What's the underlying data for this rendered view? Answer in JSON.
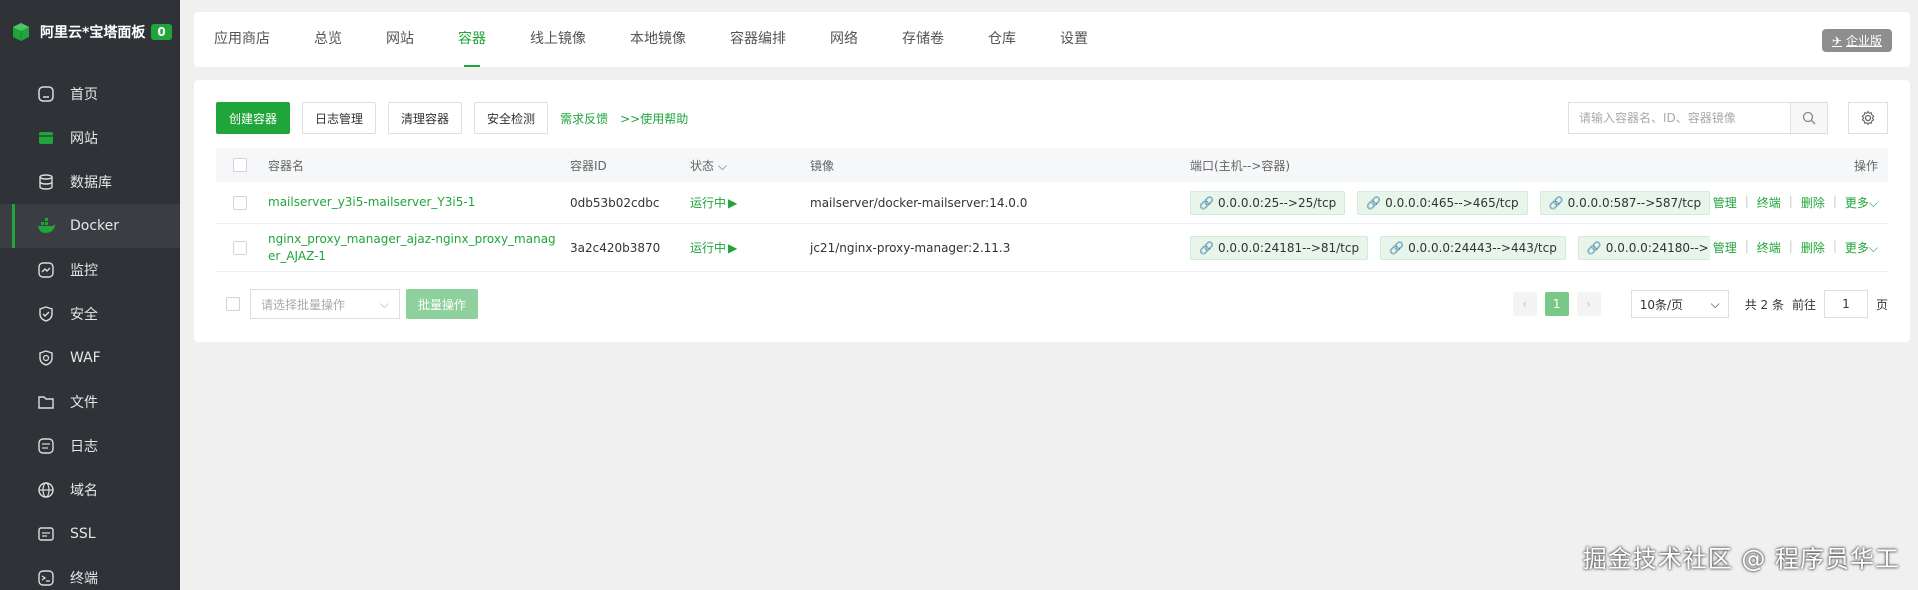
{
  "brand": {
    "title": "阿里云*宝塔面板",
    "badge": "0"
  },
  "sidebar": {
    "items": [
      {
        "label": "首页",
        "icon": "home-icon"
      },
      {
        "label": "网站",
        "icon": "globe-icon"
      },
      {
        "label": "数据库",
        "icon": "database-icon"
      },
      {
        "label": "Docker",
        "icon": "docker-icon"
      },
      {
        "label": "监控",
        "icon": "monitor-icon"
      },
      {
        "label": "安全",
        "icon": "shield-icon"
      },
      {
        "label": "WAF",
        "icon": "waf-icon"
      },
      {
        "label": "文件",
        "icon": "folder-icon"
      },
      {
        "label": "日志",
        "icon": "log-icon"
      },
      {
        "label": "域名",
        "icon": "domain-icon"
      },
      {
        "label": "SSL",
        "icon": "ssl-icon"
      },
      {
        "label": "终端",
        "icon": "terminal-icon"
      }
    ],
    "active": "Docker"
  },
  "tabs": [
    "应用商店",
    "总览",
    "网站",
    "容器",
    "线上镜像",
    "本地镜像",
    "容器编排",
    "网络",
    "存储卷",
    "仓库",
    "设置"
  ],
  "active_tab": "容器",
  "enterprise_label": "企业版",
  "toolbar": {
    "create": "创建容器",
    "logs": "日志管理",
    "clean": "清理容器",
    "security": "安全检测",
    "feedback": "需求反馈",
    "help": ">>使用帮助"
  },
  "search": {
    "placeholder": "请输入容器名、ID、容器镜像"
  },
  "table": {
    "headers": {
      "name": "容器名",
      "id": "容器ID",
      "status": "状态",
      "image": "镜像",
      "ports": "端口(主机-->容器)",
      "ops": "操作"
    },
    "rows": [
      {
        "name": "mailserver_y3i5-mailserver_Y3i5-1",
        "id": "0db53b02cdbc",
        "status": "运行中",
        "image": "mailserver/docker-mailserver:14.0.0",
        "ports": [
          "0.0.0.0:25-->25/tcp",
          "0.0.0.0:465-->465/tcp",
          "0.0.0.0:587-->587/tcp"
        ]
      },
      {
        "name": "nginx_proxy_manager_ajaz-nginx_proxy_manager_AJAZ-1",
        "id": "3a2c420b3870",
        "status": "运行中",
        "image": "jc21/nginx-proxy-manager:2.11.3",
        "ports": [
          "0.0.0.0:24181-->81/tcp",
          "0.0.0.0:24443-->443/tcp",
          "0.0.0.0:24180-->"
        ]
      }
    ],
    "ops": {
      "manage": "管理",
      "terminal": "终端",
      "delete": "删除",
      "more": "更多"
    }
  },
  "footer": {
    "batch_placeholder": "请选择批量操作",
    "batch_button": "批量操作",
    "page": "1",
    "page_size": "10条/页",
    "total": "共 2 条",
    "goto": "前往",
    "goto_value": "1",
    "page_unit": "页"
  },
  "watermark": "掘金技术社区 @ 程序员华工",
  "colors": {
    "accent": "#20a53a",
    "sidebar": "#2f3236"
  }
}
